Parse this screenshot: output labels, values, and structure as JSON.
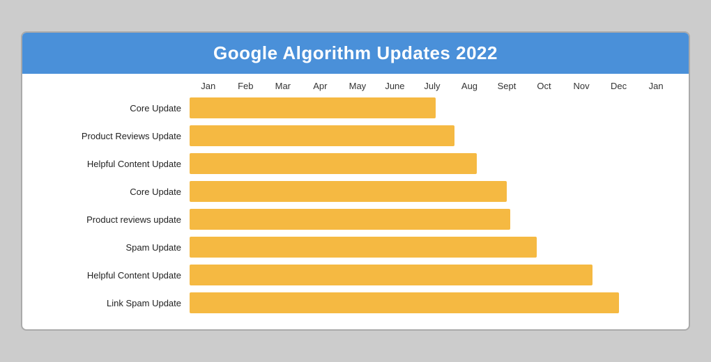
{
  "header": {
    "title": "Google Algorithm Updates 2022",
    "bg_color": "#4a90d9"
  },
  "months": [
    "Jan",
    "Feb",
    "Mar",
    "Apr",
    "May",
    "June",
    "July",
    "Aug",
    "Sept",
    "Oct",
    "Nov",
    "Dec",
    "Jan"
  ],
  "bars": [
    {
      "label": "Core Update",
      "end_month": 6.6
    },
    {
      "label": "Product Reviews Update",
      "end_month": 7.1
    },
    {
      "label": "Helpful Content Update",
      "end_month": 7.7
    },
    {
      "label": "Core Update",
      "end_month": 8.5
    },
    {
      "label": "Product reviews update",
      "end_month": 8.6
    },
    {
      "label": "Spam Update",
      "end_month": 9.3
    },
    {
      "label": "Helpful Content Update",
      "end_month": 10.8
    },
    {
      "label": "Link Spam Update",
      "end_month": 11.5
    }
  ],
  "bar_color": "#f5b942",
  "total_months": 13
}
